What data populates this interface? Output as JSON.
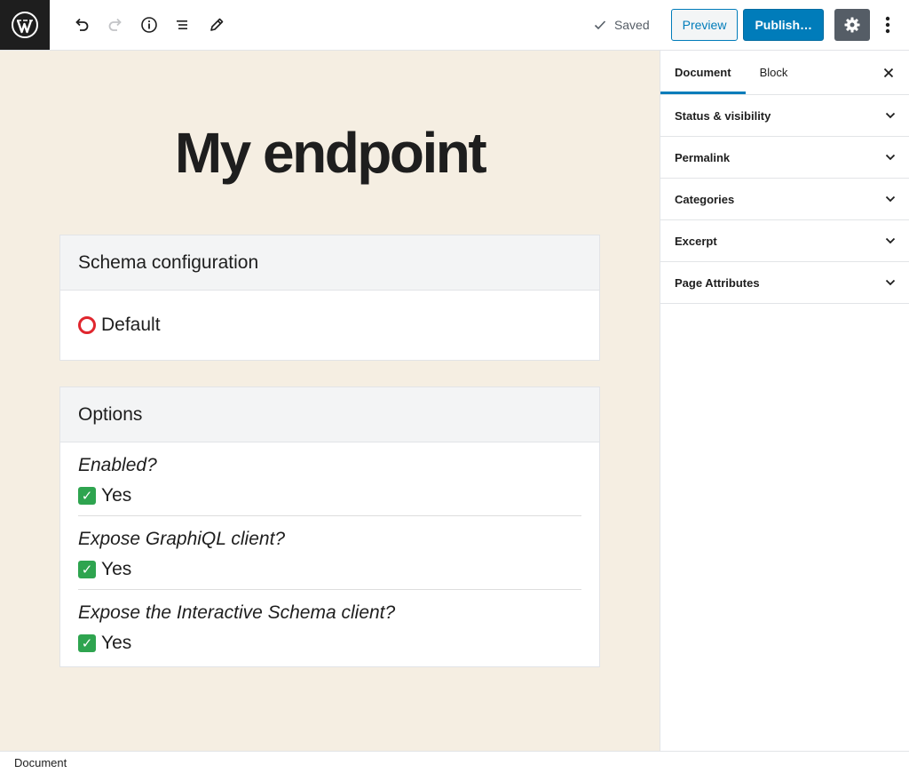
{
  "toolbar": {
    "saved_label": "Saved",
    "preview_label": "Preview",
    "publish_label": "Publish…"
  },
  "editor": {
    "title": "My endpoint",
    "schema_block": {
      "header": "Schema configuration",
      "value": "Default",
      "icon": "red-circle-icon"
    },
    "options_block": {
      "header": "Options",
      "items": [
        {
          "question": "Enabled?",
          "answer": "Yes"
        },
        {
          "question": "Expose GraphiQL client?",
          "answer": "Yes"
        },
        {
          "question": "Expose the Interactive Schema client?",
          "answer": "Yes"
        }
      ]
    }
  },
  "sidebar": {
    "tabs": [
      {
        "label": "Document",
        "active": true
      },
      {
        "label": "Block",
        "active": false
      }
    ],
    "close_icon": "close-icon",
    "panels": [
      {
        "label": "Status & visibility"
      },
      {
        "label": "Permalink"
      },
      {
        "label": "Categories"
      },
      {
        "label": "Excerpt"
      },
      {
        "label": "Page Attributes"
      }
    ]
  },
  "footer": {
    "breadcrumb": "Document"
  },
  "colors": {
    "accent": "#007cba",
    "editor_bg": "#f5eee2",
    "dark": "#1e1e1e",
    "settings_bg": "#555d66"
  }
}
